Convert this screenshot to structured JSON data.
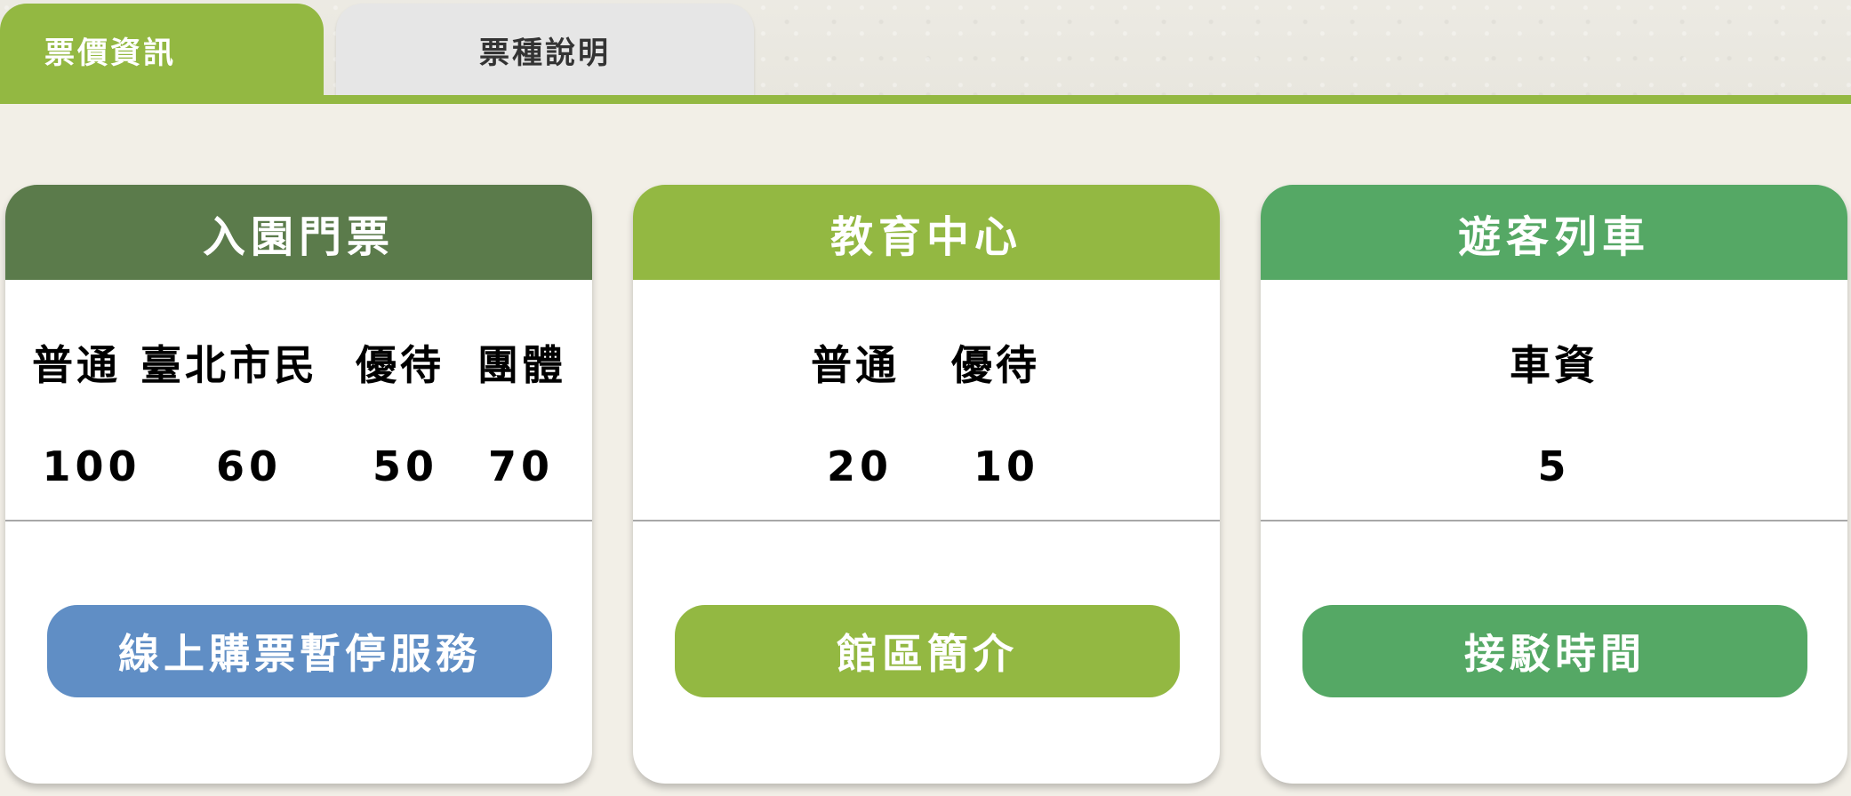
{
  "tabs": {
    "active_label": "票價資訊",
    "inactive_label": "票種說明"
  },
  "cards": {
    "admission": {
      "title": "入園門票",
      "labels": [
        "普通",
        "臺北市民",
        "優待",
        "團體"
      ],
      "values": [
        "100",
        "60",
        "50",
        "70"
      ],
      "button_label": "線上購票暫停服務"
    },
    "education": {
      "title": "教育中心",
      "labels": [
        "普通",
        "優待"
      ],
      "values": [
        "20",
        "10"
      ],
      "button_label": "館區簡介"
    },
    "train": {
      "title": "遊客列車",
      "labels": [
        "車資"
      ],
      "values": [
        "5"
      ],
      "button_label": "接駁時間"
    }
  },
  "colors": {
    "tab_active": "#93b842",
    "tab_inactive": "#e6e6e6",
    "admission_header": "#5b7b4b",
    "education_header": "#93b842",
    "train_header": "#55a865",
    "admission_button": "#608ec5",
    "page_background": "#f2efe7"
  }
}
